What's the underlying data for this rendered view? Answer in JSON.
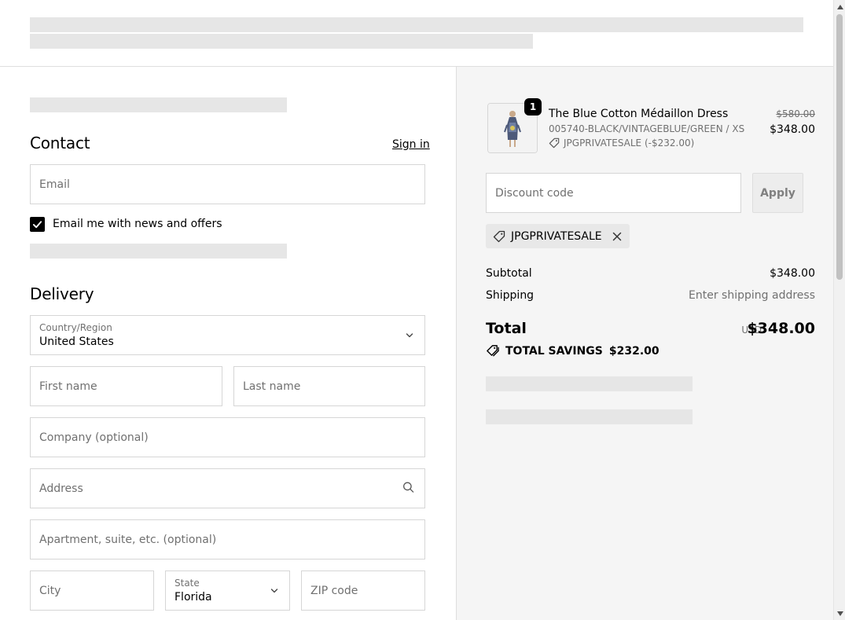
{
  "contact": {
    "heading": "Contact",
    "sign_in": "Sign in",
    "email_placeholder": "Email",
    "newsletter_label": "Email me with news and offers",
    "newsletter_checked": true
  },
  "delivery": {
    "heading": "Delivery",
    "country_label": "Country/Region",
    "country_value": "United States",
    "first_name_placeholder": "First name",
    "last_name_placeholder": "Last name",
    "company_placeholder": "Company (optional)",
    "address_placeholder": "Address",
    "apartment_placeholder": "Apartment, suite, etc. (optional)",
    "city_placeholder": "City",
    "state_label": "State",
    "state_value": "Florida",
    "zip_placeholder": "ZIP code"
  },
  "order": {
    "item": {
      "quantity": "1",
      "name": "The Blue Cotton Médaillon Dress",
      "variant": "005740-BLACK/VINTAGEBLUE/GREEN / XS",
      "discount": "JPGPRIVATESALE (-$232.00)",
      "original_price": "$580.00",
      "price": "$348.00"
    },
    "discount_placeholder": "Discount code",
    "apply_label": "Apply",
    "applied_code": "JPGPRIVATESALE",
    "subtotal_label": "Subtotal",
    "subtotal_value": "$348.00",
    "shipping_label": "Shipping",
    "shipping_value": "Enter shipping address",
    "total_label": "Total",
    "currency": "USD",
    "total_value": "$348.00",
    "savings_label": "TOTAL SAVINGS",
    "savings_value": "$232.00"
  },
  "icons": {
    "checkbox": "check-icon",
    "country_select": "chevron-down-icon",
    "address_search": "search-icon",
    "state_select": "chevron-down-icon",
    "discount_tag": "tag-icon",
    "remove_code": "close-icon",
    "savings": "tags-icon"
  },
  "colors": {
    "accent": "#000000",
    "summary_background": "#f5f5f5",
    "skeleton": "#e6e6e6",
    "muted_text": "#707070"
  }
}
